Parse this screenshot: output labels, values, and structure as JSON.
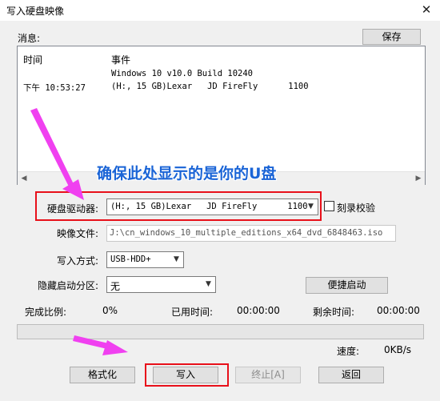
{
  "window": {
    "title": "写入硬盘映像",
    "close_glyph": "✕"
  },
  "messages": {
    "label": "消息:",
    "save_button": "保存",
    "col_time": "时间",
    "col_event": "事件",
    "rows": [
      {
        "time": "",
        "event": "Windows 10 v10.0 Build 10240"
      },
      {
        "time": "下午 10:53:27",
        "event": "(H:, 15 GB)Lexar   JD FireFly      1100"
      }
    ]
  },
  "annotation": {
    "text": "确保此处显示的是你的U盘",
    "color": "#1a64d6",
    "arrow_color": "#f040f0",
    "box_color": "#e8101a"
  },
  "form": {
    "drive_label": "硬盘驱动器:",
    "drive_value": "(H:, 15 GB)Lexar   JD FireFly      1100",
    "verify_label": "刻录校验",
    "verify_checked": false,
    "image_label": "映像文件:",
    "image_value": "J:\\cn_windows_10_multiple_editions_x64_dvd_6848463.iso",
    "method_label": "写入方式:",
    "method_value": "USB-HDD+",
    "hidden_label": "隐藏启动分区:",
    "hidden_value": "无",
    "quick_boot_button": "便捷启动"
  },
  "status": {
    "progress_label": "完成比例:",
    "progress_value": "0%",
    "progress_fraction": 0,
    "elapsed_label": "已用时间:",
    "elapsed_value": "00:00:00",
    "remaining_label": "剩余时间:",
    "remaining_value": "00:00:00",
    "speed_label": "速度:",
    "speed_value": "0KB/s"
  },
  "buttons": {
    "format": "格式化",
    "write": "写入",
    "abort": "终止[A]",
    "back": "返回"
  }
}
